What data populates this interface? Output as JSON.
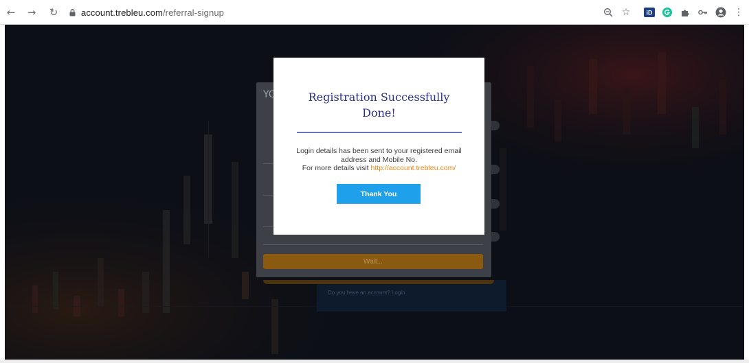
{
  "browser": {
    "url_host": "account.trebleu.com",
    "url_path": "/referral-signup",
    "icons": [
      "back-arrow-icon",
      "forward-arrow-icon",
      "reload-icon",
      "lock-icon",
      "zoom-icon",
      "star-icon",
      "id-extension-icon",
      "grammarly-icon",
      "puzzle-icon",
      "key-icon",
      "profile-icon",
      "menu-dots-icon"
    ]
  },
  "signup": {
    "title_fragment": "YO",
    "wait_label": "Wait...",
    "account_prompt": "Do you have an account? Login"
  },
  "modal": {
    "title_line1": "Registration Successfully",
    "title_line2": "Done!",
    "message_line1": "Login details has been sent to your registered email",
    "message_line2": "address and Mobile No.",
    "message_line3_prefix": "For more details visit ",
    "message_link": "http://account.trebleu.com/",
    "button_label": "Thank You"
  },
  "colors": {
    "title": "#2a2f8c",
    "rule": "#6b74c9",
    "button": "#1ea1ea",
    "link": "#e8891e",
    "overlay": "#0c0f16"
  }
}
